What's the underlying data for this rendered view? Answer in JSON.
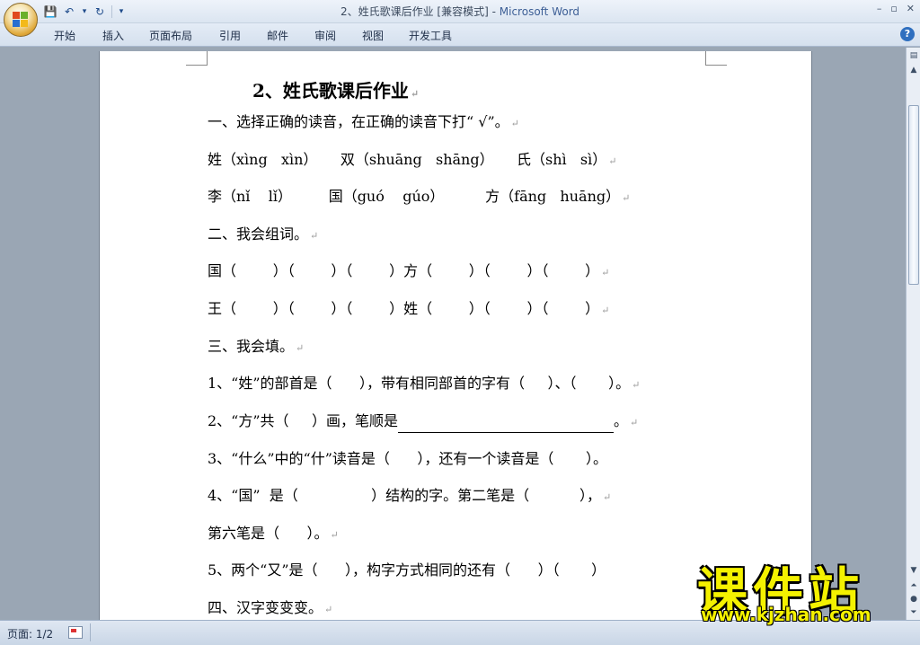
{
  "window": {
    "doc_name": "2、姓氏歌课后作业 [兼容模式]",
    "app_name": "Microsoft Word",
    "min": "–",
    "max": "▫",
    "close": "✕"
  },
  "qat": {
    "save": "💾",
    "undo": "↶",
    "redo": "↻",
    "customize": "▾"
  },
  "tabs": [
    "开始",
    "插入",
    "页面布局",
    "引用",
    "邮件",
    "审阅",
    "视图",
    "开发工具"
  ],
  "help": "?",
  "document": {
    "title": "2、姓氏歌课后作业",
    "lines": [
      "一、选择正确的读音，在正确的读音下打“ √”。",
      "姓（xìng   xìn）     双（shuāng   shāng）     氏（shì   sì）",
      "李（nǐ    lǐ）        国（guó    gúo）         方（fāng   huāng）",
      "二、我会组词。",
      "国（        ）（        ）（        ）方（        ）（        ）（        ）",
      "王（        ）（        ）（        ）姓（        ）（        ）（        ）",
      "三、我会填。",
      "1、“姓”的部首是（      ），带有相同部首的字有（     ）、（       ）。",
      "2、“方”共（     ）画，笔顺是",
      "3、“什么”中的“什”读音是（      ），还有一个读音是（       ）。",
      "4、“国”  是（                ）结构的字。第二笔是（           ），",
      "第六笔是（      ）。",
      "5、两个“又”是（      ），构字方式相同的还有（      ）（       ）",
      "四、汉字变变变。"
    ],
    "line2_tail": "。",
    "para_mark": "↵"
  },
  "status": {
    "page": "页面: 1/2"
  },
  "watermark": {
    "cn": "课件站",
    "url": "www.kjzhan.com"
  }
}
